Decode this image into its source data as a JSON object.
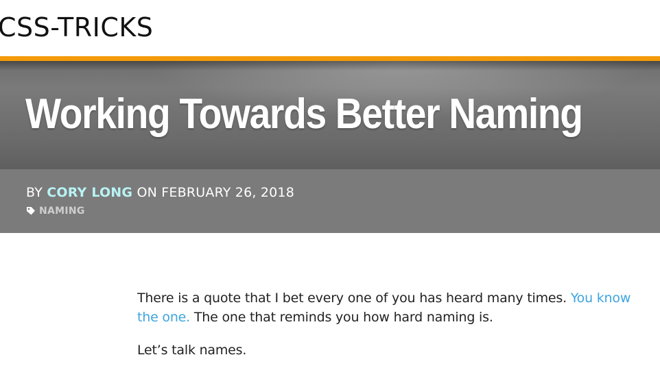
{
  "site": {
    "logo_text": "CSS-TRICKS"
  },
  "colors": {
    "accent_bar": "#f39a0b",
    "author_link": "#b9f3f4",
    "inline_link": "#3ea4e0",
    "hero_background": "#707070",
    "meta_background": "#7b7b7b"
  },
  "article": {
    "title": "Working Towards Better Naming",
    "byline": {
      "prefix": "BY",
      "author": "CORY LONG",
      "date_prefix": "ON",
      "date": "FEBRUARY 26, 2018"
    },
    "tags": [
      {
        "icon": "tag-icon",
        "label": "NAMING"
      }
    ],
    "paragraphs": [
      {
        "text_before": "There is a quote that I bet every one of you has heard many times.",
        "link_text": "You know the one.",
        "text_after": "The one that reminds you how hard naming is."
      },
      {
        "text": "Let’s talk names."
      }
    ]
  }
}
